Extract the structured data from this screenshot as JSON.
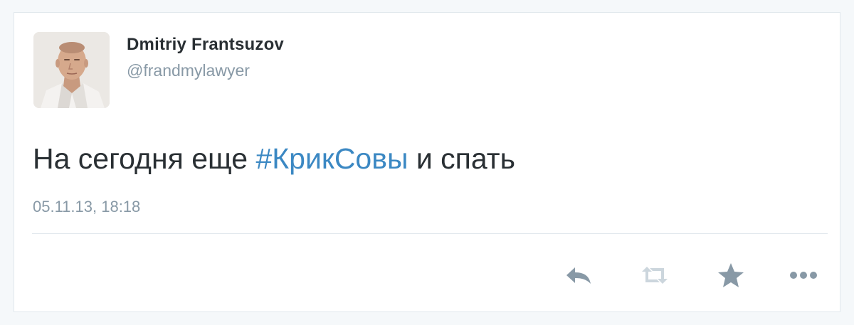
{
  "tweet": {
    "author_name": "Dmitriy Frantsuzov",
    "author_handle": "@frandmylawyer",
    "text_before": "На сегодня еще ",
    "hashtag": "#КрикСовы",
    "text_after": " и спать",
    "timestamp": "05.11.13, 18:18"
  },
  "actions": [
    {
      "name": "reply",
      "icon": "reply-icon"
    },
    {
      "name": "retweet",
      "icon": "retweet-icon"
    },
    {
      "name": "favorite",
      "icon": "star-icon"
    },
    {
      "name": "more",
      "icon": "more-icon"
    }
  ],
  "colors": {
    "text": "#292f33",
    "muted": "#8899a6",
    "hashtag": "#3b88c3",
    "action_icon": "#8899a6",
    "retweet_icon": "#ccd6dd",
    "border": "#e1e8ed"
  }
}
